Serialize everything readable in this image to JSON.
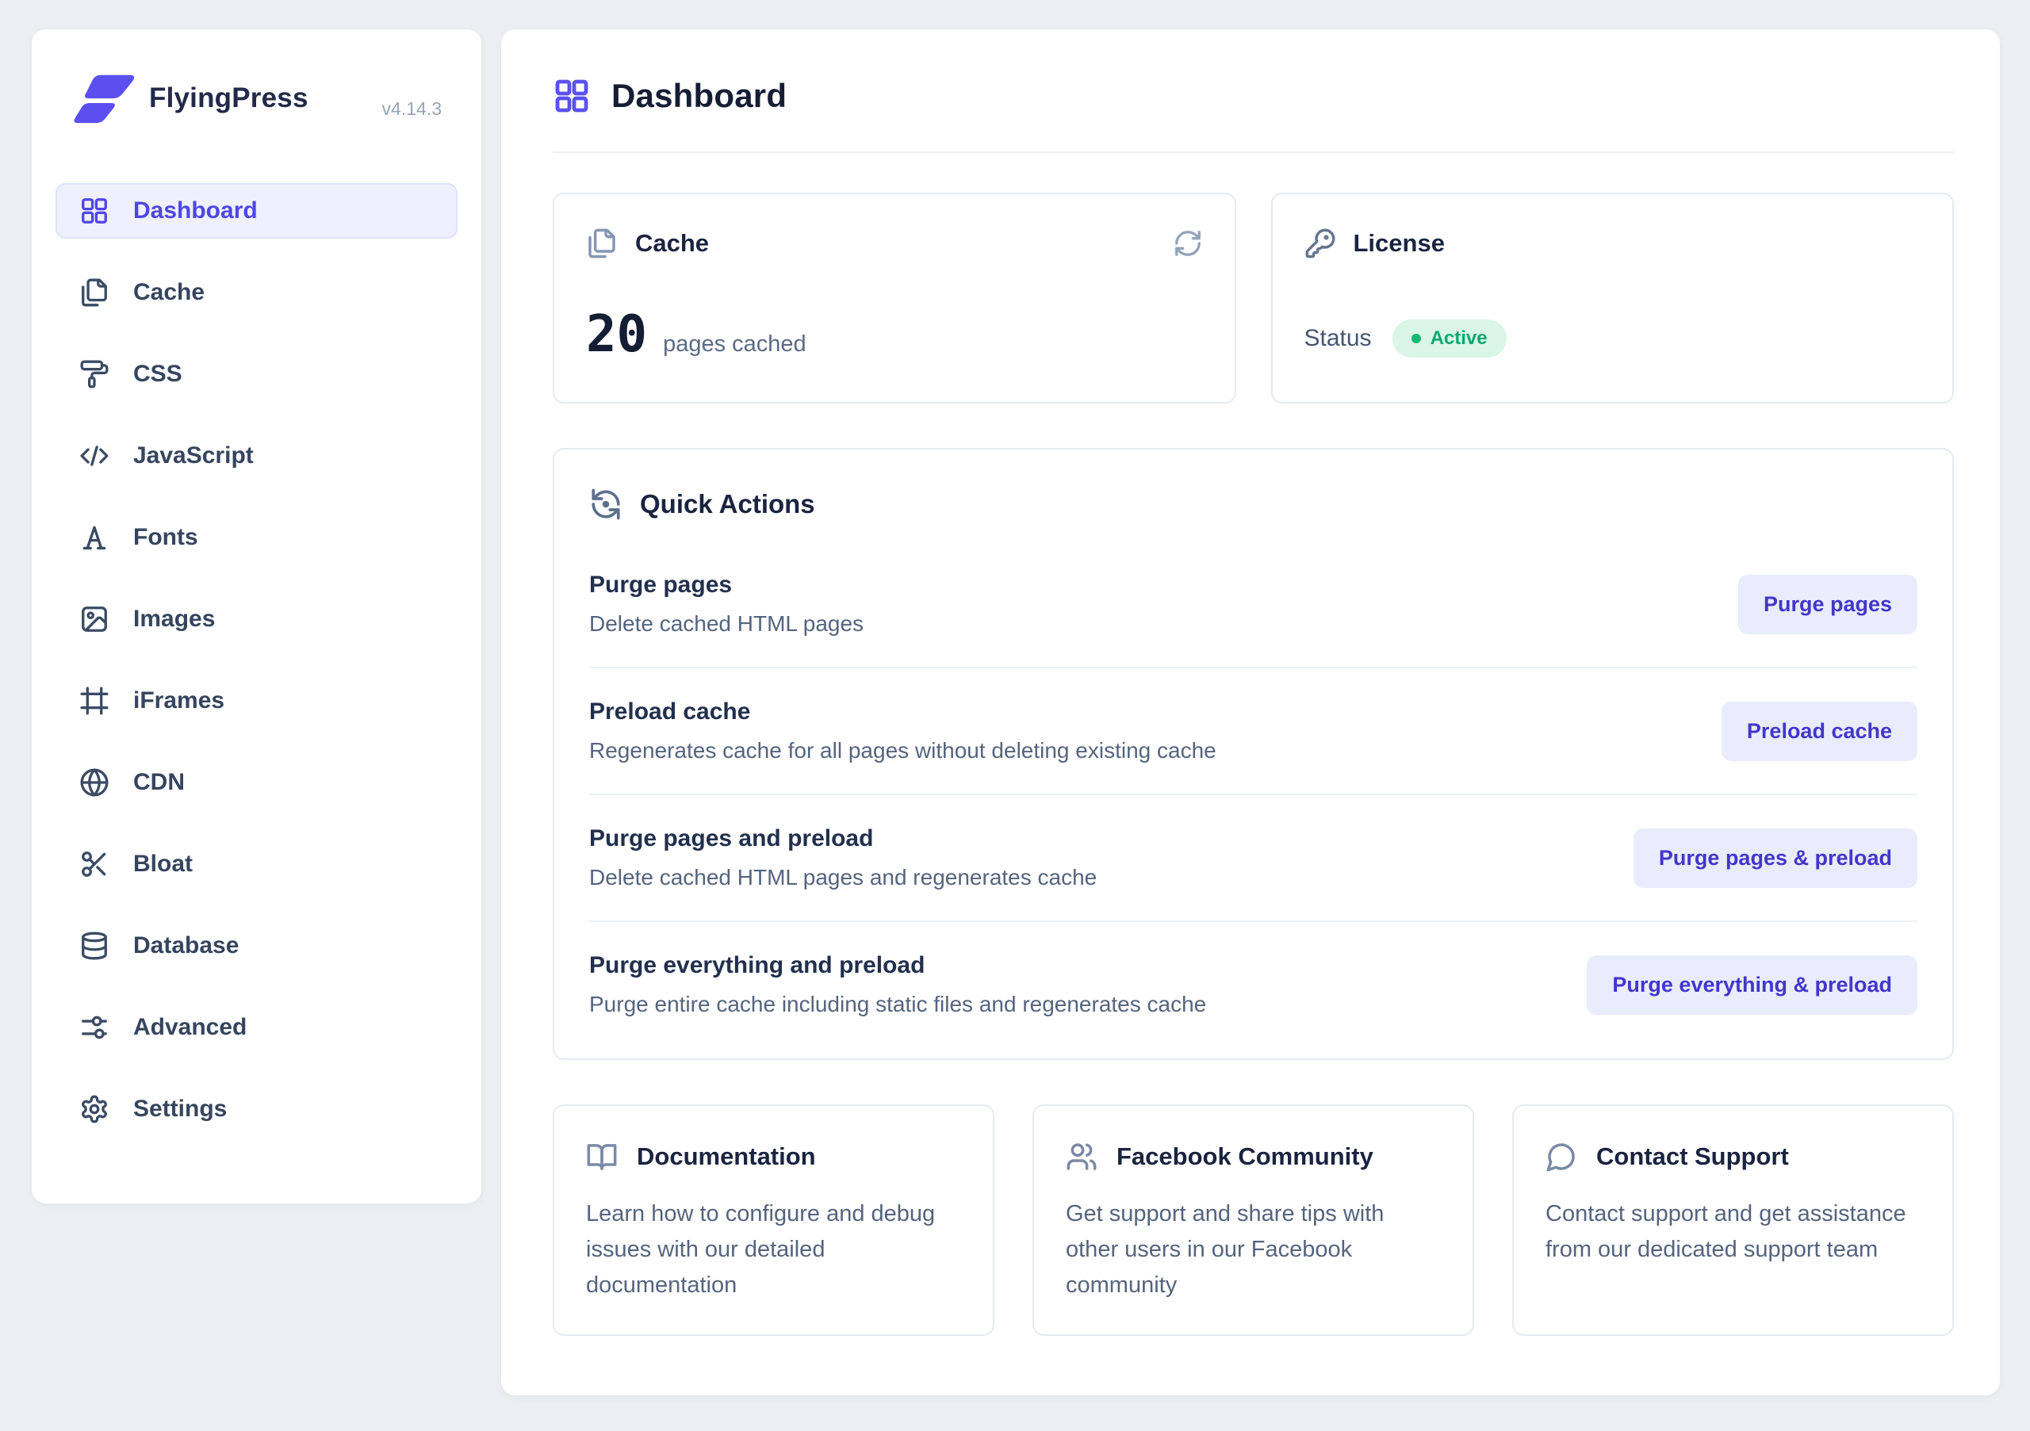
{
  "app": {
    "name": "FlyingPress",
    "version": "v4.14.3"
  },
  "sidebar": {
    "items": [
      {
        "label": "Dashboard",
        "icon": "grid-icon",
        "active": true
      },
      {
        "label": "Cache",
        "icon": "pages-icon",
        "active": false
      },
      {
        "label": "CSS",
        "icon": "paint-roller-icon",
        "active": false
      },
      {
        "label": "JavaScript",
        "icon": "code-icon",
        "active": false
      },
      {
        "label": "Fonts",
        "icon": "letter-a-icon",
        "active": false
      },
      {
        "label": "Images",
        "icon": "image-icon",
        "active": false
      },
      {
        "label": "iFrames",
        "icon": "frame-icon",
        "active": false
      },
      {
        "label": "CDN",
        "icon": "globe-icon",
        "active": false
      },
      {
        "label": "Bloat",
        "icon": "scissors-icon",
        "active": false
      },
      {
        "label": "Database",
        "icon": "database-icon",
        "active": false
      },
      {
        "label": "Advanced",
        "icon": "sliders-icon",
        "active": false
      },
      {
        "label": "Settings",
        "icon": "gear-icon",
        "active": false
      }
    ]
  },
  "header": {
    "title": "Dashboard"
  },
  "cache_card": {
    "title": "Cache",
    "value": "20",
    "unit": "pages cached"
  },
  "license_card": {
    "title": "License",
    "status_label": "Status",
    "status_value": "Active"
  },
  "quick_actions": {
    "title": "Quick Actions",
    "rows": [
      {
        "title": "Purge pages",
        "description": "Delete cached HTML pages",
        "button": "Purge pages"
      },
      {
        "title": "Preload cache",
        "description": "Regenerates cache for all pages without deleting existing cache",
        "button": "Preload cache"
      },
      {
        "title": "Purge pages and preload",
        "description": "Delete cached HTML pages and regenerates cache",
        "button": "Purge pages & preload"
      },
      {
        "title": "Purge everything and preload",
        "description": "Purge entire cache including static files and regenerates cache",
        "button": "Purge everything & preload"
      }
    ]
  },
  "help_cards": [
    {
      "title": "Documentation",
      "description": "Learn how to configure and debug issues with our detailed documentation"
    },
    {
      "title": "Facebook Community",
      "description": "Get support and share tips with other users in our Facebook community"
    },
    {
      "title": "Contact Support",
      "description": "Contact support and get assistance from our dedicated support team"
    }
  ],
  "colors": {
    "accent": "#4f46e5",
    "logo": "#5b4ff0",
    "button_bg": "#e9ecfc",
    "button_text": "#4236ca",
    "badge_bg": "#d9f6e6",
    "badge_text": "#0ca86d",
    "page_bg": "#edeff2"
  }
}
